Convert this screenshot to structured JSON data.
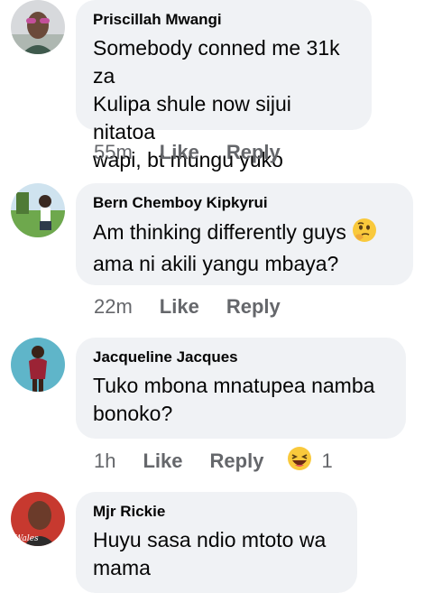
{
  "comments": [
    {
      "author": "Priscillah Mwangi",
      "text": "Somebody conned me 31k za\nKulipa shule now sijui nitatoa\nwapi, bt mungu yuko",
      "time": "55m",
      "like": "Like",
      "reply": "Reply"
    },
    {
      "author": "Bern Chemboy Kipkyrui",
      "text": "Am thinking differently guys",
      "text_line2": "ama ni akili yangu mbaya?",
      "emoji": "thinking-face",
      "time": "22m",
      "like": "Like",
      "reply": "Reply"
    },
    {
      "author": "Jacqueline Jacques",
      "text": "Tuko mbona mnatupea namba\nbonoko?",
      "time": "1h",
      "like": "Like",
      "reply": "Reply",
      "reaction": {
        "emoji": "laughing-face",
        "count": "1"
      }
    },
    {
      "author": "Mjr Rickie",
      "text": "Huyu sasa ndio mtoto wa\nmama",
      "avatar_text": "Wales"
    }
  ]
}
